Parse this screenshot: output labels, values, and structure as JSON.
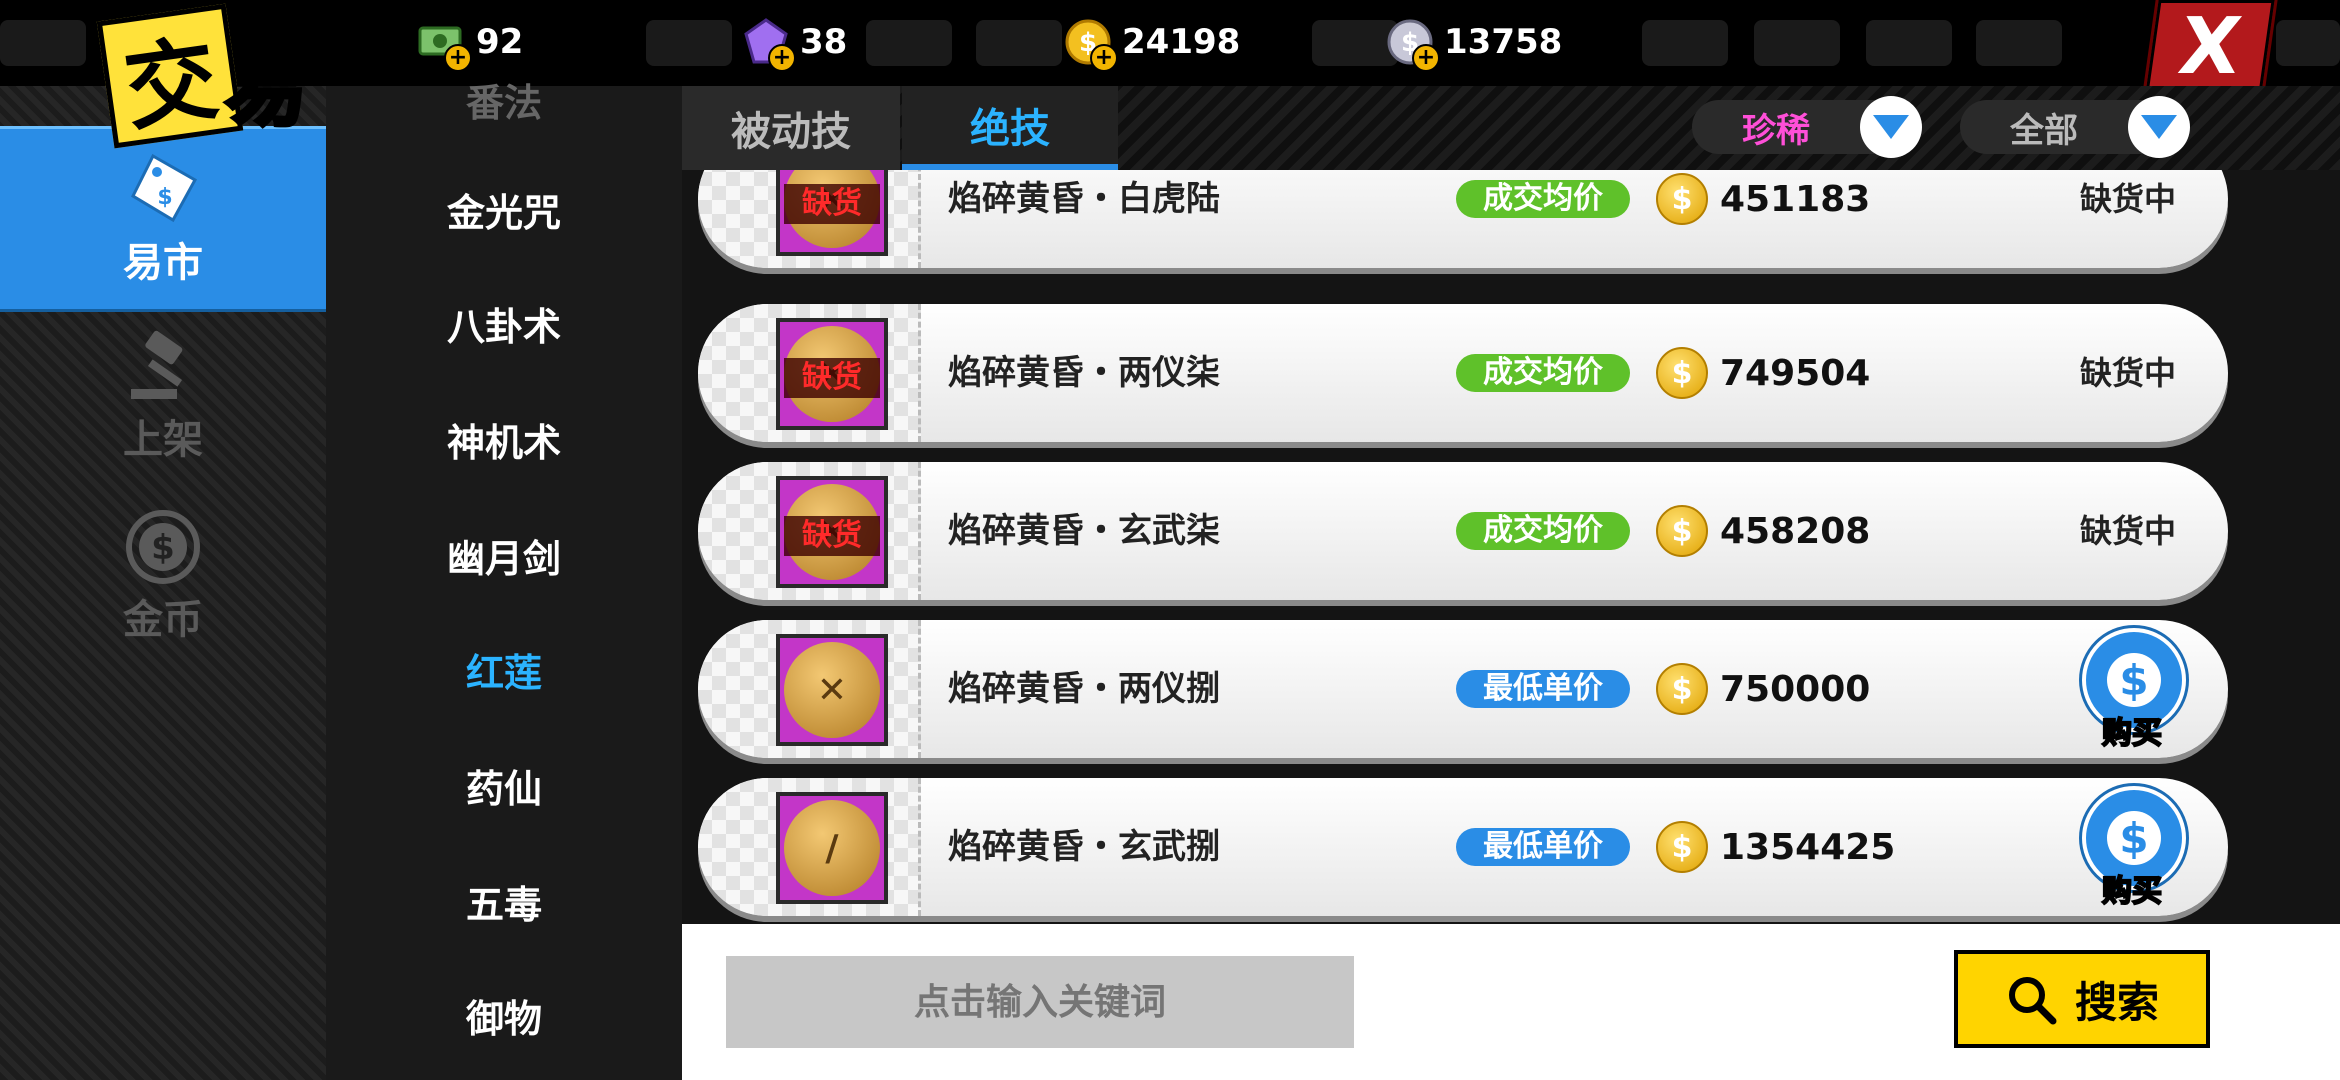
{
  "logo": {
    "char1": "交",
    "char2": "易"
  },
  "currencies": [
    {
      "name": "cash",
      "value": "92"
    },
    {
      "name": "gem",
      "value": "38"
    },
    {
      "name": "gold-coin",
      "value": "24198"
    },
    {
      "name": "silver-coin",
      "value": "13758"
    }
  ],
  "close_label": "X",
  "sidebar": {
    "items": [
      {
        "label": "易市",
        "icon": "price-tag-icon"
      },
      {
        "label": "上架",
        "icon": "auction-hammer-icon"
      },
      {
        "label": "金币",
        "icon": "dollar-coin-icon"
      }
    ]
  },
  "categories": [
    "番法",
    "金光咒",
    "八卦术",
    "神机术",
    "幽月剑",
    "红莲",
    "药仙",
    "五毒",
    "御物"
  ],
  "active_category": "红莲",
  "tabs": [
    "被动技",
    "绝技"
  ],
  "active_tab": "绝技",
  "filters": {
    "rarity": "珍稀",
    "scope": "全部"
  },
  "listings": [
    {
      "name": "焰碎黄昏・白虎陆",
      "tag": "成交均价",
      "price": "451183",
      "status": "缺货中",
      "out_of_stock": "缺货"
    },
    {
      "name": "焰碎黄昏・两仪柒",
      "tag": "成交均价",
      "price": "749504",
      "status": "缺货中",
      "out_of_stock": "缺货"
    },
    {
      "name": "焰碎黄昏・玄武柒",
      "tag": "成交均价",
      "price": "458208",
      "status": "缺货中",
      "out_of_stock": "缺货"
    },
    {
      "name": "焰碎黄昏・两仪捌",
      "tag": "最低单价",
      "price": "750000",
      "buy": "购买"
    },
    {
      "name": "焰碎黄昏・玄武捌",
      "tag": "最低单价",
      "price": "1354425",
      "buy": "购买"
    }
  ],
  "colors": {
    "tag_avg": "#5fc12a",
    "tag_low": "#2a8de6",
    "accent_blue": "#2a8de6",
    "rarity_pink": "#ff4fd8"
  },
  "search": {
    "placeholder": "点击输入关键词",
    "button_label": "搜索"
  }
}
